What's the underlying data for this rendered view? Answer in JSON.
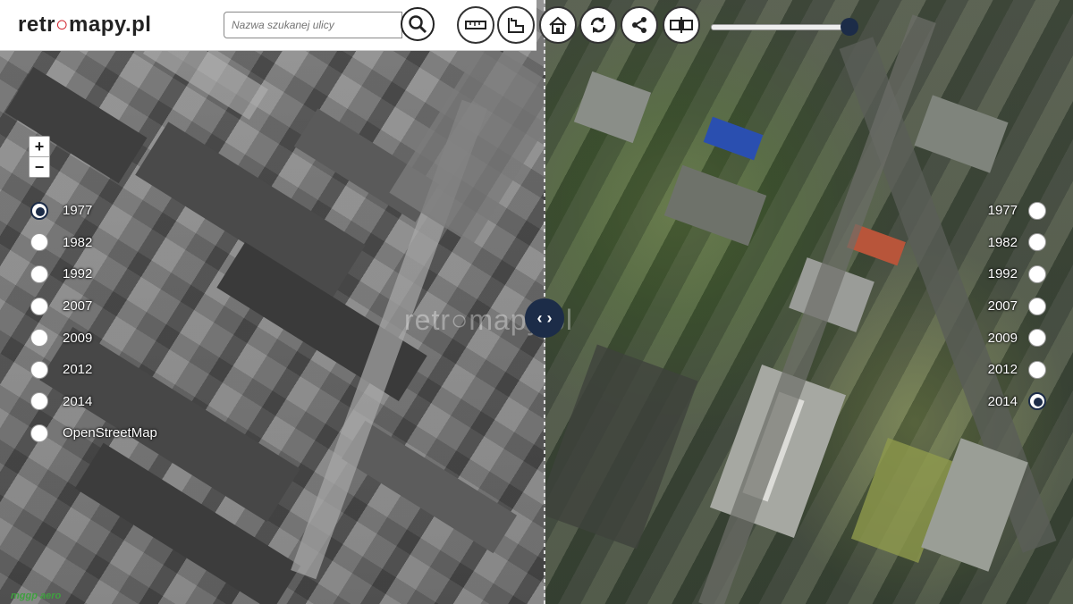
{
  "app": {
    "logo_text_a": "retr",
    "logo_text_b": "mapy.pl"
  },
  "search": {
    "placeholder": "Nazwa szukanej ulicy"
  },
  "map": {
    "watermark": "retr○mapy.pl",
    "swipe_handle_glyph": "‹ ›",
    "credit": "mggp aero",
    "opacity_percent": 100
  },
  "zoom": {
    "in": "+",
    "out": "−"
  },
  "left_layers": {
    "selected": "1977",
    "items": [
      "1977",
      "1982",
      "1992",
      "2007",
      "2009",
      "2012",
      "2014",
      "OpenStreetMap"
    ]
  },
  "right_layers": {
    "selected": "2014",
    "items": [
      "1977",
      "1982",
      "1992",
      "2007",
      "2009",
      "2012",
      "2014"
    ]
  },
  "toolbar": {
    "icons": [
      "ruler-icon",
      "area-measure-icon",
      "home-icon",
      "refresh-icon",
      "share-icon",
      "compare-icon"
    ]
  }
}
